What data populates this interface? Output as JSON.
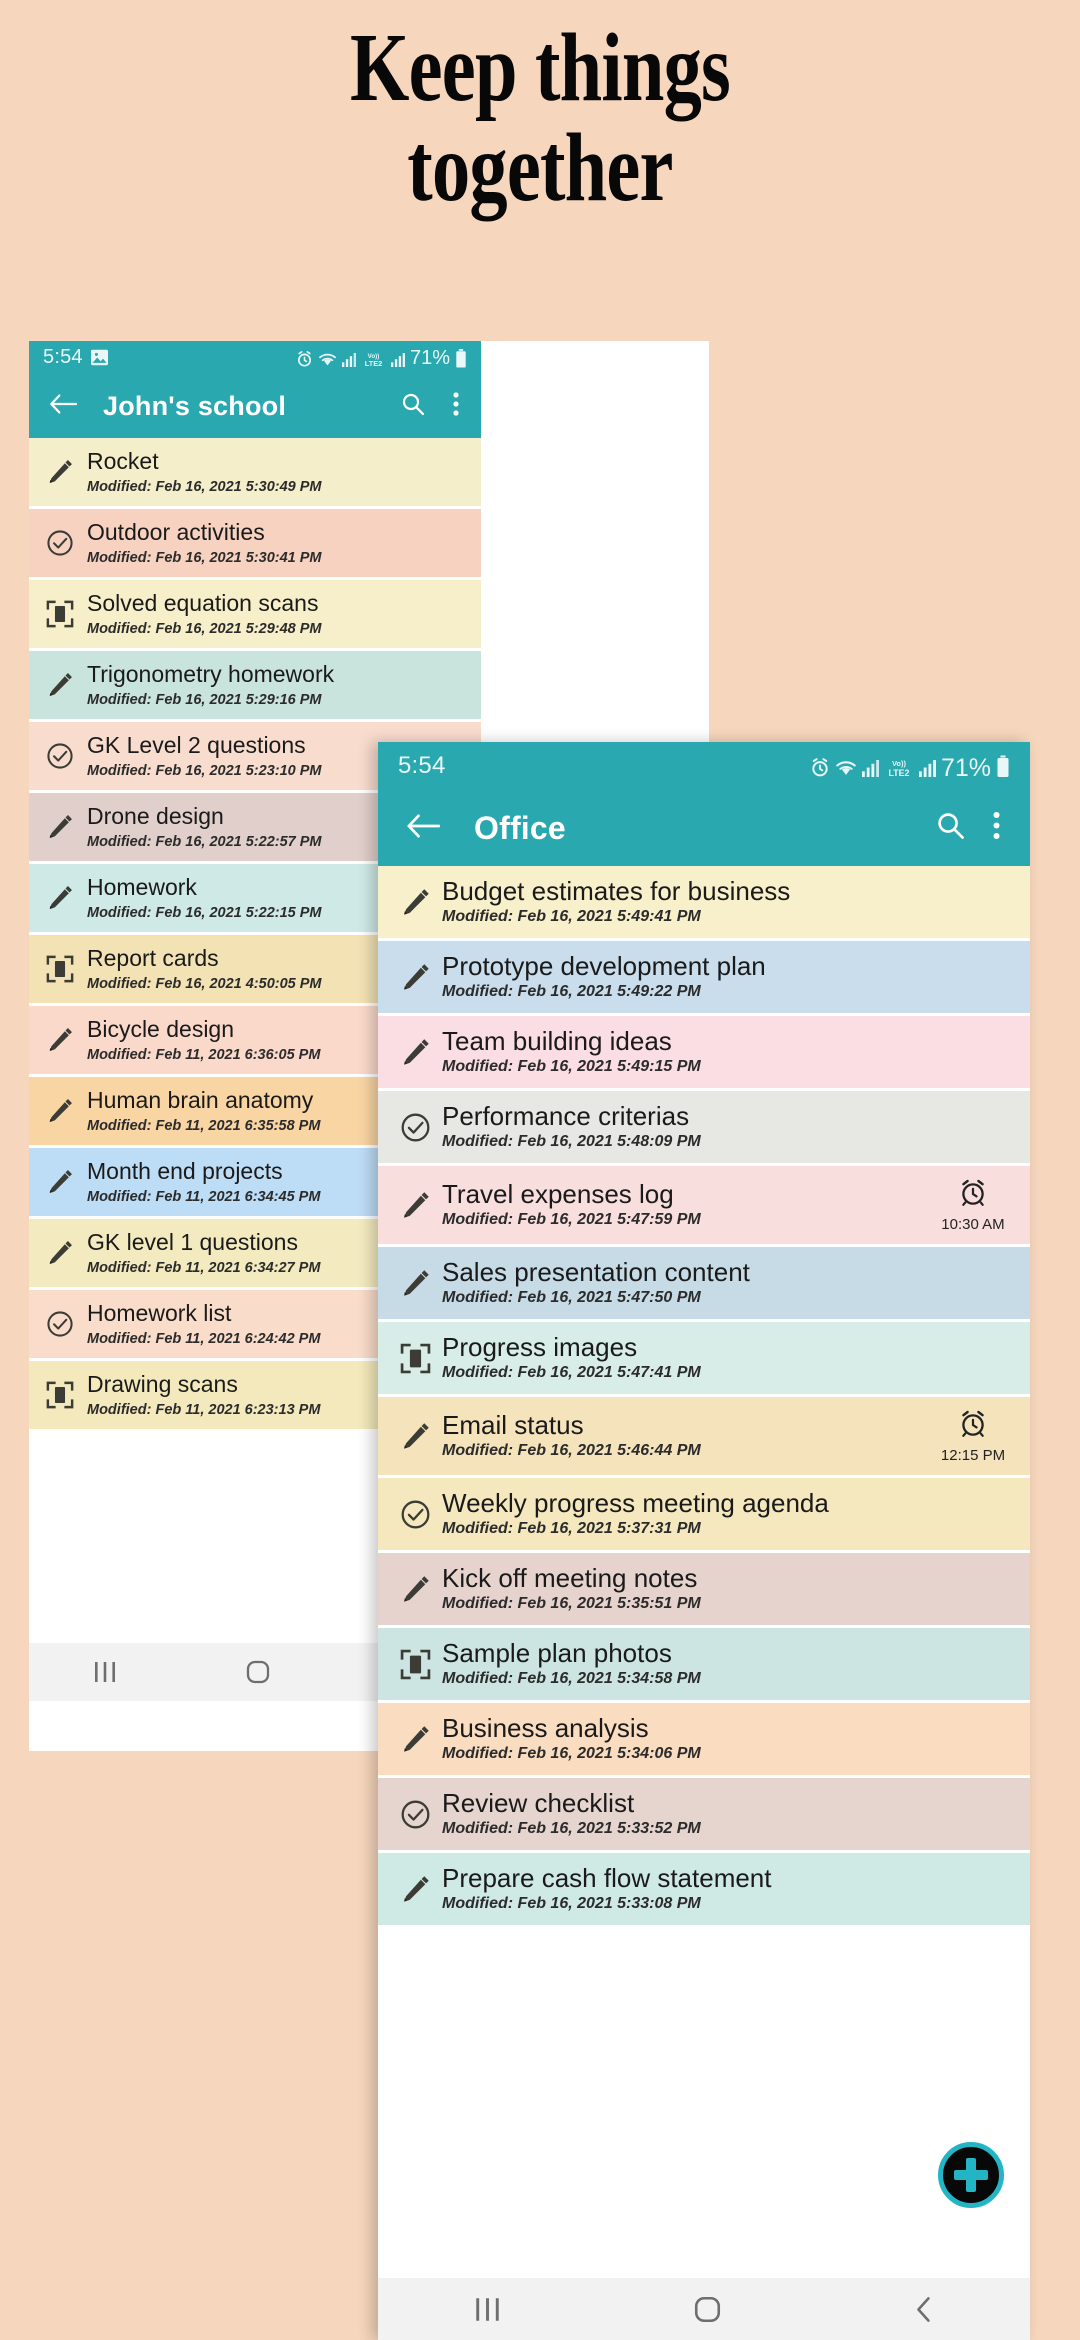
{
  "headline": {
    "line1": "Keep things",
    "line2": "together"
  },
  "colors": {
    "page_bg": "#F6D6BC",
    "teal": "#2AA8B0",
    "fab_ring": "#23B5C4",
    "fab_fill": "#080808",
    "navbar_bg": "#F2F2F2"
  },
  "phone1": {
    "status": {
      "time": "5:54",
      "left_icons": [
        "image-icon"
      ],
      "right_icons": [
        "alarm-icon",
        "wifi-icon",
        "signal-icon",
        "volte2-icon",
        "signal2-icon"
      ],
      "network_label": "Vo))\nLTE2",
      "battery_percent": "71%"
    },
    "appbar": {
      "back_icon": "arrow-back-icon",
      "title": "John's school",
      "search_icon": "search-icon",
      "overflow_icon": "more-vert-icon"
    },
    "notes": [
      {
        "icon": "pencil-icon",
        "title": "Rocket",
        "modified": "Modified: Feb 16, 2021 5:30:49 PM",
        "bg": "#F5EECB"
      },
      {
        "icon": "check-circle-icon",
        "title": "Outdoor activities",
        "modified": "Modified: Feb 16, 2021 5:30:41 PM",
        "bg": "#F7D2C0"
      },
      {
        "icon": "scan-icon",
        "title": "Solved equation scans",
        "modified": "Modified: Feb 16, 2021 5:29:48 PM",
        "bg": "#F6EFC9"
      },
      {
        "icon": "pencil-icon",
        "title": "Trigonometry homework",
        "modified": "Modified: Feb 16, 2021 5:29:16 PM",
        "bg": "#C9E4DD"
      },
      {
        "icon": "check-circle-icon",
        "title": "GK Level 2 questions",
        "modified": "Modified: Feb 16, 2021 5:23:10 PM",
        "bg": "#F8DCCE"
      },
      {
        "icon": "pencil-icon",
        "title": "Drone design",
        "modified": "Modified: Feb 16, 2021 5:22:57 PM",
        "bg": "#E0CFCB"
      },
      {
        "icon": "pencil-icon",
        "title": "Homework",
        "modified": "Modified: Feb 16, 2021 5:22:15 PM",
        "bg": "#CFE9E6"
      },
      {
        "icon": "scan-icon",
        "title": "Report cards",
        "modified": "Modified: Feb 16, 2021 4:50:05 PM",
        "bg": "#F2E2B4"
      },
      {
        "icon": "pencil-icon",
        "title": "Bicycle design",
        "modified": "Modified: Feb 11, 2021 6:36:05 PM",
        "bg": "#FAD9CB"
      },
      {
        "icon": "pencil-icon",
        "title": "Human brain anatomy",
        "modified": "Modified: Feb 11, 2021 6:35:58 PM",
        "bg": "#F9D5A4"
      },
      {
        "icon": "pencil-icon",
        "title": "Month end projects",
        "modified": "Modified: Feb 11, 2021 6:34:45 PM",
        "bg": "#BDDCF5"
      },
      {
        "icon": "pencil-icon",
        "title": "GK level 1 questions",
        "modified": "Modified: Feb 11, 2021 6:34:27 PM",
        "bg": "#F3EBBF"
      },
      {
        "icon": "check-circle-icon",
        "title": "Homework list",
        "modified": "Modified: Feb 11, 2021 6:24:42 PM",
        "bg": "#F9DCC9"
      },
      {
        "icon": "scan-icon",
        "title": "Drawing scans",
        "modified": "Modified: Feb 11, 2021 6:23:13 PM",
        "bg": "#F3E9BC"
      }
    ],
    "navbar": {
      "recents_icon": "recents-icon",
      "home_icon": "home-icon",
      "back_icon": "back-chevron-icon"
    }
  },
  "phone2": {
    "status": {
      "time": "5:54",
      "right_icons": [
        "alarm-icon",
        "wifi-icon",
        "signal-icon",
        "volte2-icon",
        "signal2-icon"
      ],
      "network_label": "Vo))\nLTE2",
      "battery_percent": "71%"
    },
    "appbar": {
      "back_icon": "arrow-back-icon",
      "title": "Office",
      "search_icon": "search-icon",
      "overflow_icon": "more-vert-icon"
    },
    "notes": [
      {
        "icon": "pencil-icon",
        "title": "Budget estimates for business",
        "modified": "Modified: Feb 16, 2021 5:49:41 PM",
        "bg": "#F8EFCB",
        "alarm": null
      },
      {
        "icon": "pencil-icon",
        "title": "Prototype development plan",
        "modified": "Modified: Feb 16, 2021 5:49:22 PM",
        "bg": "#C9DDEC",
        "alarm": null
      },
      {
        "icon": "pencil-icon",
        "title": "Team building ideas",
        "modified": "Modified: Feb 16, 2021 5:49:15 PM",
        "bg": "#FBDDE4",
        "alarm": null
      },
      {
        "icon": "check-circle-icon",
        "title": "Performance criterias",
        "modified": "Modified: Feb 16, 2021 5:48:09 PM",
        "bg": "#E7E8E3",
        "alarm": null
      },
      {
        "icon": "pencil-icon",
        "title": "Travel expenses log",
        "modified": "Modified: Feb 16, 2021 5:47:59 PM",
        "bg": "#F9DEDE",
        "alarm": "10:30 AM"
      },
      {
        "icon": "pencil-icon",
        "title": "Sales presentation content",
        "modified": "Modified: Feb 16, 2021 5:47:50 PM",
        "bg": "#C6DBE6",
        "alarm": null
      },
      {
        "icon": "scan-icon",
        "title": "Progress images",
        "modified": "Modified: Feb 16, 2021 5:47:41 PM",
        "bg": "#D8EDE8",
        "alarm": null
      },
      {
        "icon": "pencil-icon",
        "title": "Email status",
        "modified": "Modified: Feb 16, 2021 5:46:44 PM",
        "bg": "#F5E3BC",
        "alarm": "12:15 PM"
      },
      {
        "icon": "check-circle-icon",
        "title": "Weekly progress meeting agenda",
        "modified": "Modified: Feb 16, 2021 5:37:31 PM",
        "bg": "#F6E8BE",
        "alarm": null
      },
      {
        "icon": "pencil-icon",
        "title": "Kick off meeting notes",
        "modified": "Modified: Feb 16, 2021 5:35:51 PM",
        "bg": "#E7D3CE",
        "alarm": null
      },
      {
        "icon": "scan-icon",
        "title": "Sample plan photos",
        "modified": "Modified: Feb 16, 2021 5:34:58 PM",
        "bg": "#CCE5E2",
        "alarm": null
      },
      {
        "icon": "pencil-icon",
        "title": "Business analysis",
        "modified": "Modified: Feb 16, 2021 5:34:06 PM",
        "bg": "#FADCC1",
        "alarm": null
      },
      {
        "icon": "check-circle-icon",
        "title": "Review checklist",
        "modified": "Modified: Feb 16, 2021 5:33:52 PM",
        "bg": "#E6D4CF",
        "alarm": null
      },
      {
        "icon": "pencil-icon",
        "title": "Prepare cash flow statement",
        "modified": "Modified: Feb 16, 2021 5:33:08 PM",
        "bg": "#CFE9E4",
        "alarm": null
      }
    ],
    "fab": {
      "icon": "add-icon",
      "label": "+"
    },
    "navbar": {
      "recents_icon": "recents-icon",
      "home_icon": "home-icon",
      "back_icon": "back-chevron-icon"
    }
  }
}
